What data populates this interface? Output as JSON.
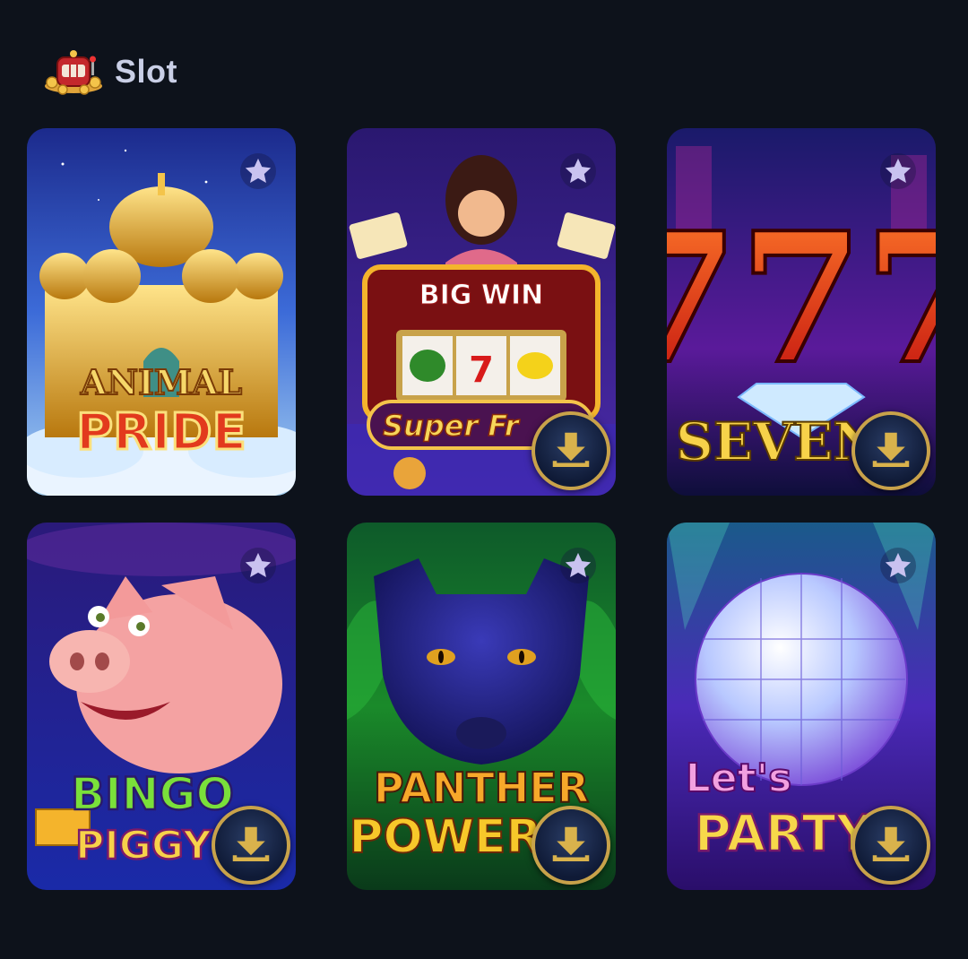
{
  "section": {
    "title": "Slot",
    "icon": "slot-machine-icon"
  },
  "games": [
    {
      "id": "animal-pride",
      "title_line1": "ANIMAL",
      "title_line2": "PRIDE",
      "favorite_icon": "star-icon",
      "show_download": false
    },
    {
      "id": "super-fruit",
      "title_line1": "BIG WIN",
      "title_line2": "Super Fr",
      "favorite_icon": "star-icon",
      "show_download": true,
      "download_icon": "download-icon",
      "reel_symbol": "7"
    },
    {
      "id": "seven",
      "title_line1": "777",
      "title_line2": "SEVEN",
      "favorite_icon": "star-icon",
      "show_download": true,
      "download_icon": "download-icon"
    },
    {
      "id": "bingo-piggy",
      "title_line1": "BINGO",
      "title_line2": "PIGGY",
      "favorite_icon": "star-icon",
      "show_download": true,
      "download_icon": "download-icon"
    },
    {
      "id": "panther-power",
      "title_line1": "PANTHER",
      "title_line2": "POWER",
      "favorite_icon": "star-icon",
      "show_download": true,
      "download_icon": "download-icon"
    },
    {
      "id": "lets-party",
      "title_line1": "Let's",
      "title_line2": "PARTY",
      "favorite_icon": "star-icon",
      "show_download": true,
      "download_icon": "download-icon"
    }
  ],
  "colors": {
    "background": "#0d121b",
    "title": "#c9cfe6",
    "star": "#c9c2f0",
    "download_ring": "#c8a24a"
  }
}
